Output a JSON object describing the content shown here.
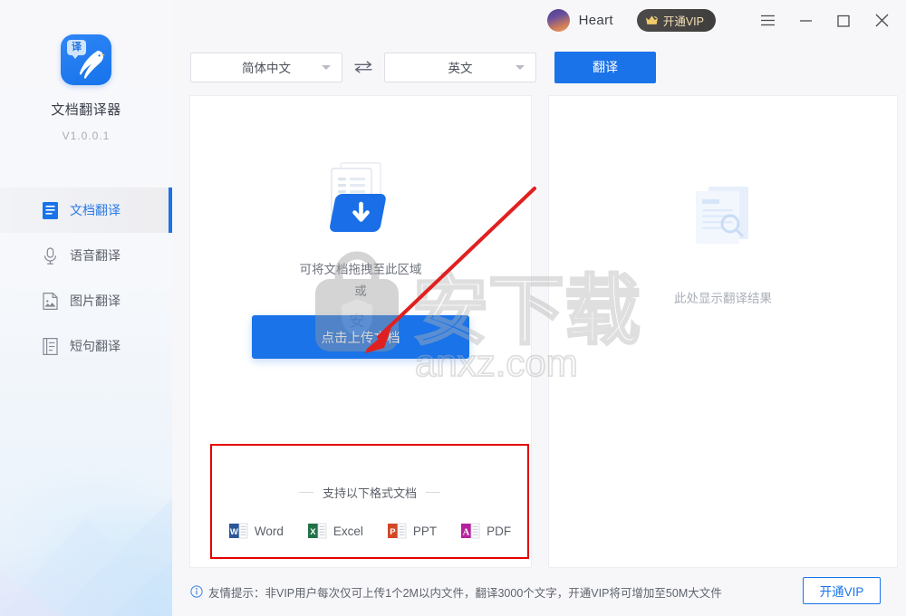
{
  "sidebar": {
    "app_title": "文档翻译器",
    "version": "V1.0.0.1",
    "logo_badge_text": "译",
    "items": [
      {
        "label": "文档翻译",
        "icon": "document-icon",
        "active": true
      },
      {
        "label": "语音翻译",
        "icon": "microphone-icon",
        "active": false
      },
      {
        "label": "图片翻译",
        "icon": "image-icon",
        "active": false
      },
      {
        "label": "短句翻译",
        "icon": "text-lines-icon",
        "active": false
      }
    ]
  },
  "titlebar": {
    "user_name": "Heart",
    "vip_label": "开通VIP",
    "menu_icon": "hamburger-menu-icon",
    "minimize_icon": "minimize-icon",
    "maximize_icon": "maximize-icon",
    "close_icon": "close-icon"
  },
  "toolbar": {
    "source_language": "简体中文",
    "target_language": "英文",
    "swap_icon": "swap-arrows-icon",
    "translate_label": "翻译"
  },
  "upload": {
    "drop_hint_line1": "可将文档拖拽至此区域",
    "drop_hint_line2": "或",
    "upload_button_label": "点击上传文档",
    "illustration_icon": "document-upload-icon"
  },
  "formats": {
    "title": "支持以下格式文档",
    "items": [
      {
        "label": "Word",
        "letter": "W",
        "color": "#2B579A"
      },
      {
        "label": "Excel",
        "letter": "X",
        "color": "#217346"
      },
      {
        "label": "PPT",
        "letter": "P",
        "color": "#D24726"
      },
      {
        "label": "PDF",
        "letter": "A",
        "color": "#B7219E"
      }
    ]
  },
  "result": {
    "empty_text": "此处显示翻译结果",
    "illustration_icon": "document-search-icon"
  },
  "footer": {
    "info_icon": "info-circle-icon",
    "tip_text": "友情提示：非VIP用户每次仅可上传1个2M以内文件，翻译3000个文字，开通VIP将可增加至50M大文件",
    "vip_label": "开通VIP"
  },
  "watermark": {
    "main_text": "安下载",
    "sub_text": "anxz.com",
    "badge_text": "安"
  },
  "annotations": {
    "arrow_color": "#e02020",
    "box_color": "#e60000"
  },
  "colors": {
    "accent": "#1a73e8",
    "active_nav": "#2b7ae8",
    "vip_pill_bg": "#433f3e",
    "vip_pill_text": "#f3e0b5",
    "page_bg": "#f7f7fa"
  }
}
